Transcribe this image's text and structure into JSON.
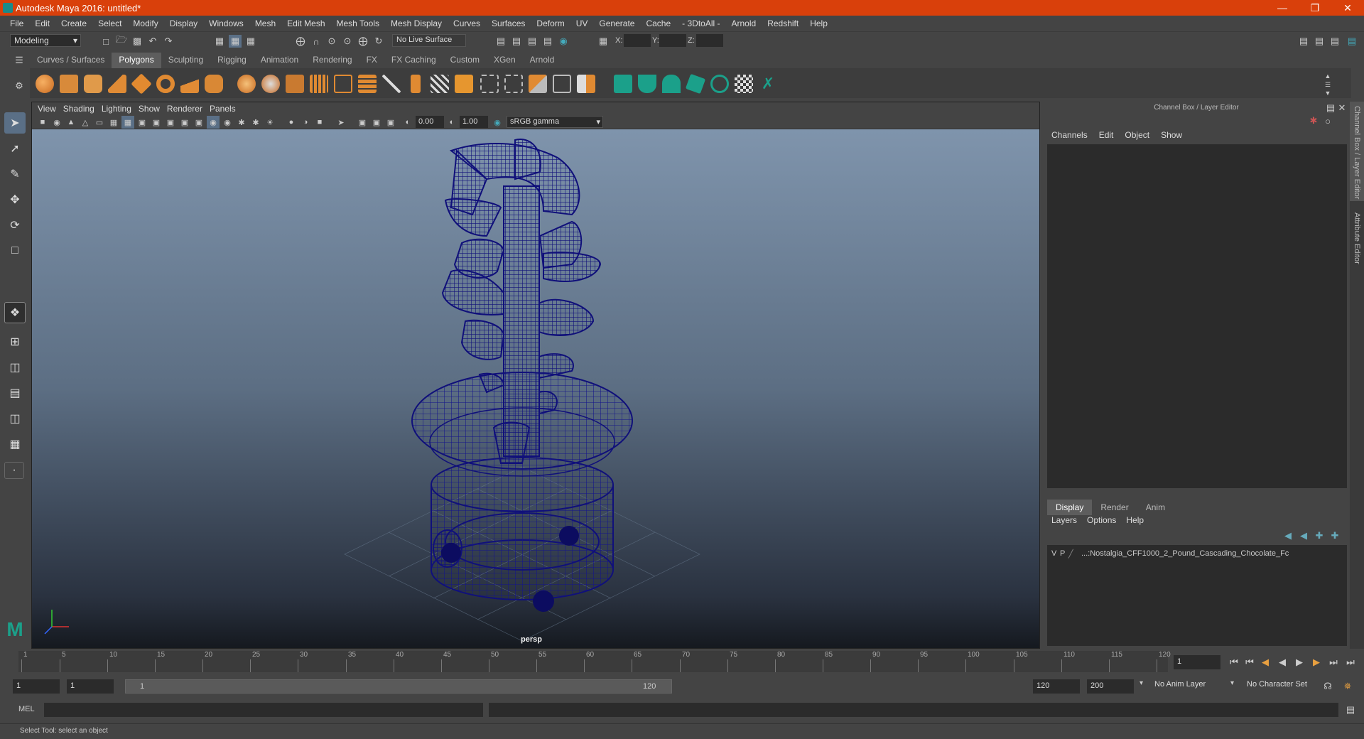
{
  "title": "Autodesk Maya 2016: untitled*",
  "menus": [
    "File",
    "Edit",
    "Create",
    "Select",
    "Modify",
    "Display",
    "Windows",
    "Mesh",
    "Edit Mesh",
    "Mesh Tools",
    "Mesh Display",
    "Curves",
    "Surfaces",
    "Deform",
    "UV",
    "Generate",
    "Cache",
    "- 3DtoAll -",
    "Arnold",
    "Redshift",
    "Help"
  ],
  "statusline": {
    "mode": "Modeling",
    "live_surface": "No Live Surface",
    "x_label": "X:",
    "y_label": "Y:",
    "z_label": "Z:"
  },
  "shelf_tabs": [
    "Curves / Surfaces",
    "Polygons",
    "Sculpting",
    "Rigging",
    "Animation",
    "Rendering",
    "FX",
    "FX Caching",
    "Custom",
    "XGen",
    "Arnold"
  ],
  "shelf_active": "Polygons",
  "viewport": {
    "menus": [
      "View",
      "Shading",
      "Lighting",
      "Show",
      "Renderer",
      "Panels"
    ],
    "exposure": "0.00",
    "gamma": "1.00",
    "colorspace": "sRGB gamma",
    "camera_label": "persp"
  },
  "channel_box": {
    "title": "Channel Box / Layer Editor",
    "menus": [
      "Channels",
      "Edit",
      "Object",
      "Show"
    ]
  },
  "layer_editor": {
    "tabs": [
      "Display",
      "Render",
      "Anim"
    ],
    "active_tab": "Display",
    "menus": [
      "Layers",
      "Options",
      "Help"
    ],
    "layers": [
      {
        "v": "V",
        "p": "P",
        "name": "...:Nostalgia_CFF1000_2_Pound_Cascading_Chocolate_Fc"
      }
    ]
  },
  "side_tabs": [
    "Channel Box / Layer Editor",
    "Attribute Editor"
  ],
  "timeline": {
    "ticks": [
      "1",
      "5",
      "10",
      "15",
      "20",
      "25",
      "30",
      "35",
      "40",
      "45",
      "50",
      "55",
      "60",
      "65",
      "70",
      "75",
      "80",
      "85",
      "90",
      "95",
      "100",
      "105",
      "110",
      "115",
      "120"
    ],
    "current_frame": "1"
  },
  "range": {
    "start": "1",
    "playback_start": "1",
    "slider_start": "1",
    "slider_end": "120",
    "playback_end": "120",
    "end": "200",
    "anim_layer": "No Anim Layer",
    "character_set": "No Character Set"
  },
  "command": {
    "label": "MEL"
  },
  "help_line": "Select Tool: select an object",
  "colors": {
    "titlebar": "#d9400b",
    "wireframe": "#10107a",
    "panel": "#444444"
  }
}
